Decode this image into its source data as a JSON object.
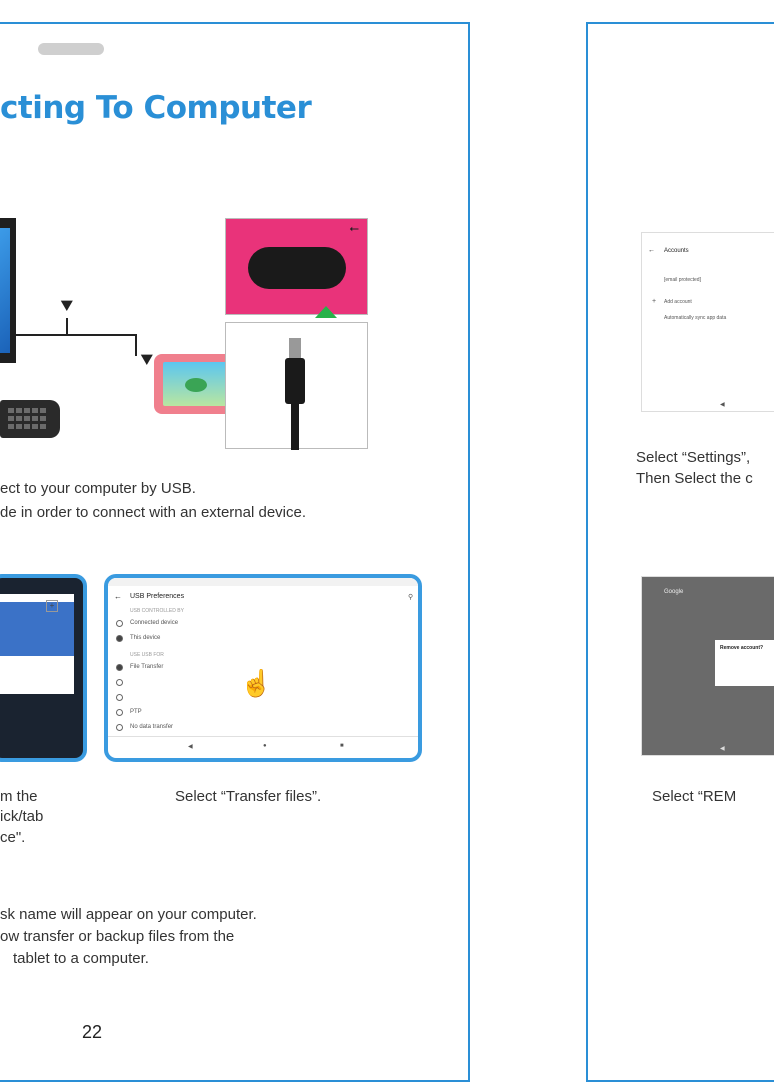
{
  "left_page": {
    "title": "cting To Computer",
    "instruction_line1": "ect to your computer by USB.",
    "instruction_line2": "de in order to connect with  an external device.",
    "usb_prefs": {
      "header": "USB Preferences",
      "section1": "USB CONTROLLED BY",
      "opt1": "Connected device",
      "opt2": "This device",
      "section2": "USE USB FOR",
      "opt3": "File Transfer",
      "opt4": "PTP",
      "opt5": "No data transfer"
    },
    "caption_left_1": "m the",
    "caption_left_2": "ick/tab",
    "caption_left_3": "ce\".",
    "caption_transfer": "Select “Transfer files”.",
    "note_line1": "sk name will appear on your computer.",
    "note_line2": "ow transfer or backup files from the",
    "note_line3": "tablet to a computer.",
    "page_number": "22"
  },
  "right_page": {
    "accounts_header": "Accounts",
    "account_email": "[email protected]",
    "add_account": "Add account",
    "auto_sync": "Automatically sync app data",
    "caption_settings_1": "Select “Settings”,",
    "caption_settings_2": "Then Select the c",
    "google_header": "Google",
    "dialog_title": "Remove account?",
    "caption_remove": "Select “REM"
  },
  "colors": {
    "accent": "#2a8fd6",
    "usb_pink": "#e9337a",
    "arrow_green": "#27b24a"
  }
}
